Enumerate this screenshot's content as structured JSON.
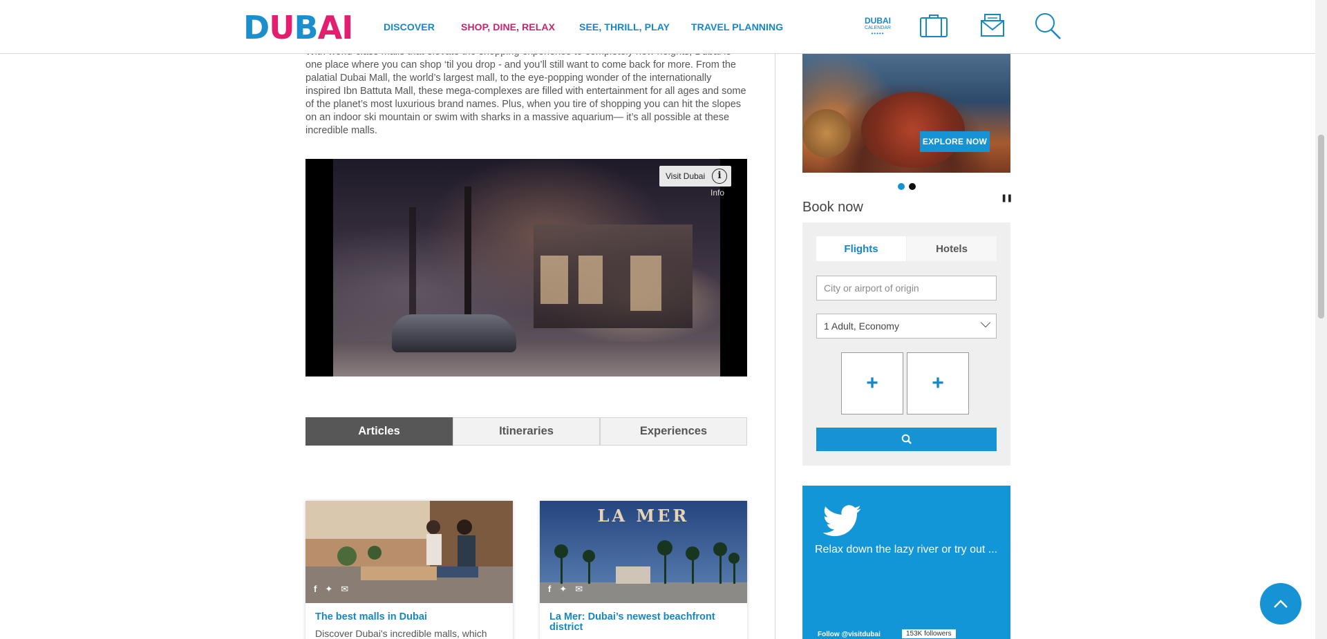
{
  "header": {
    "logo": {
      "letters": [
        "D",
        "U",
        "B",
        "AI"
      ]
    },
    "nav": [
      {
        "label": "DISCOVER",
        "active": false
      },
      {
        "label": "SHOP, DINE, RELAX",
        "active": true
      },
      {
        "label": "SEE, THRILL, PLAY",
        "active": false
      },
      {
        "label": "TRAVEL PLANNING",
        "active": false
      }
    ],
    "calendar": {
      "line1": "DUBAI",
      "line2": "CALENDAR"
    },
    "icons": [
      "suitcase-icon",
      "mail-icon",
      "search-icon"
    ]
  },
  "intro": {
    "text": "With world-class malls that elevate the shopping experience to completely new heights, Dubai is one place where you can shop ‘til you drop - and you’ll still want to come back for more. From the palatial Dubai Mall, the world’s largest mall, to the eye-popping wonder of the internationally inspired Ibn Battuta Mall, these mega-complexes are filled with entertainment for all ages and some of the planet’s most luxurious brand names. Plus, when you tire of shopping you can hit the slopes on an indoor ski mountain or swim with sharks in a massive aquarium— it’s all possible at these incredible malls."
  },
  "video": {
    "channel": "Visit Dubai",
    "info_label": "Info"
  },
  "tabs": [
    {
      "label": "Articles",
      "active": true
    },
    {
      "label": "Itineraries",
      "active": false
    },
    {
      "label": "Experiences",
      "active": false
    }
  ],
  "cards": [
    {
      "title": "The best malls in Dubai",
      "desc": "Discover Dubai's incredible malls, which"
    },
    {
      "title": "La Mer: Dubai’s newest beachfront district",
      "desc": "",
      "sign": "LA MER"
    }
  ],
  "promo": {
    "button": "EXPLORE NOW",
    "dots": [
      {
        "active": true
      },
      {
        "active": false
      }
    ]
  },
  "book": {
    "title": "Book now",
    "tabs": [
      {
        "label": "Flights",
        "active": true
      },
      {
        "label": "Hotels",
        "active": false
      }
    ],
    "origin_placeholder": "City or airport of origin",
    "passengers": "1 Adult, Economy",
    "date_buttons": [
      "+",
      "+"
    ]
  },
  "twitter": {
    "text": "Relax down the lazy river or try out ...",
    "follow": "Follow @visitdubai",
    "followers": "153K followers"
  },
  "colors": {
    "brand_blue": "#1593d4",
    "brand_pink": "#c2276e"
  }
}
